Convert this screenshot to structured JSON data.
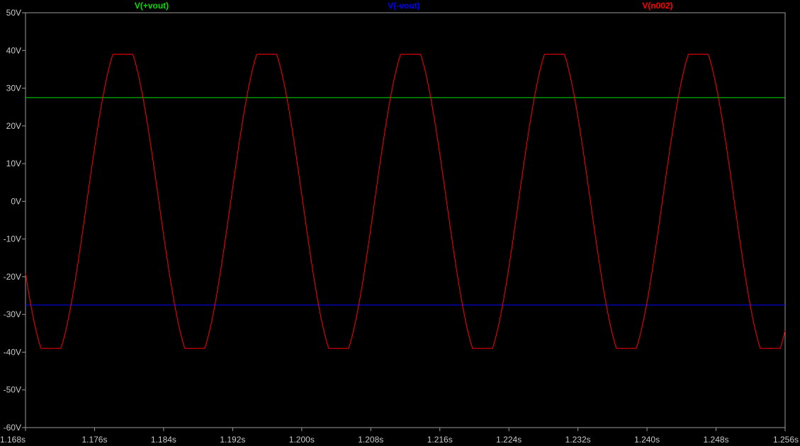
{
  "chart_data": {
    "type": "line",
    "xlim": [
      1.168,
      1.256
    ],
    "ylim": [
      -60,
      50
    ],
    "x_ticks": [
      "1.168s",
      "1.176s",
      "1.184s",
      "1.192s",
      "1.200s",
      "1.208s",
      "1.216s",
      "1.224s",
      "1.232s",
      "1.240s",
      "1.248s",
      "1.256s"
    ],
    "x_tick_values": [
      1.168,
      1.176,
      1.184,
      1.192,
      1.2,
      1.208,
      1.216,
      1.224,
      1.232,
      1.24,
      1.248,
      1.256
    ],
    "y_ticks": [
      "50V",
      "40V",
      "30V",
      "20V",
      "10V",
      "0V",
      "-10V",
      "-20V",
      "-30V",
      "-40V",
      "-50V",
      "-60V"
    ],
    "y_tick_values": [
      50,
      40,
      30,
      20,
      10,
      0,
      -10,
      -20,
      -30,
      -40,
      -50,
      -60
    ],
    "grid": false,
    "legend_placement": "top",
    "series": [
      {
        "name": "V(+vout)",
        "color": "#00e000",
        "kind": "constant",
        "value": 27.5
      },
      {
        "name": "V(-vout)",
        "color": "#0000ff",
        "kind": "constant",
        "value": -27.5
      },
      {
        "name": "V(n002)",
        "color": "#ff0000",
        "kind": "clipped_sine",
        "amplitude": 43,
        "clip": 39,
        "frequency_hz": 60,
        "phase_peak_time": 1.17928,
        "x_start": 1.168,
        "x_end": 1.256,
        "y_start": -19,
        "y_end": -31
      }
    ]
  }
}
